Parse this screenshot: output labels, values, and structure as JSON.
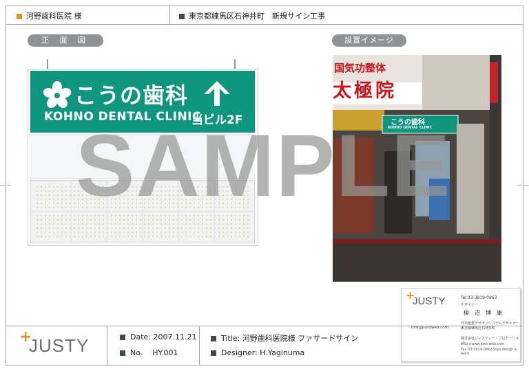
{
  "header": {
    "client": "河野歯科医院 様",
    "location": "東京都練馬区石神井町　新規サイン工事",
    "client_square_color": "#f28c1c",
    "location_square_color": "#3c4b57"
  },
  "labels": {
    "front_view": "正 面 図",
    "installation_image": "設置イメージ"
  },
  "sign": {
    "name_jp": "こうの歯科",
    "name_en": "KOHNO DENTAL CLINIC",
    "floor": "当ビル2F",
    "arrow_icon": "arrow-up-icon",
    "logo_icon": "flower-icon",
    "green": "#10957f"
  },
  "photo": {
    "banner_top": "国気功整体",
    "banner_big": "太極院",
    "sign_small": "こうの歯科",
    "sign_small_en": "KOHNO DENTAL CLINIC"
  },
  "watermark": "SAMPLE",
  "card": {
    "logo": "JUSTY",
    "tel": "Tel.03-3819-0863",
    "role": "デザイナー",
    "person": "柳　沼　博　康",
    "email": "info@justyweb.com",
    "addr1": "日本産業デザインシステムデザイナー",
    "addr2": "東京都練馬区石神井町",
    "company": "株式会社ジャスティー・プロモーション",
    "url": "http://www.justyweb.com",
    "fax": "Fax.03-3819-0862  Sign design & work"
  },
  "footer": {
    "logo": "JUSTY",
    "date_label": "Date:",
    "date_value": "2007.11.21",
    "no_label": "No.",
    "no_value": "HY.001",
    "title_label": "Title:",
    "title_value": "河野歯科医院様 ファサードサイン",
    "designer_label": "Designer:",
    "designer_value": "H.Yaginuma",
    "accent": "#f28c1c"
  }
}
